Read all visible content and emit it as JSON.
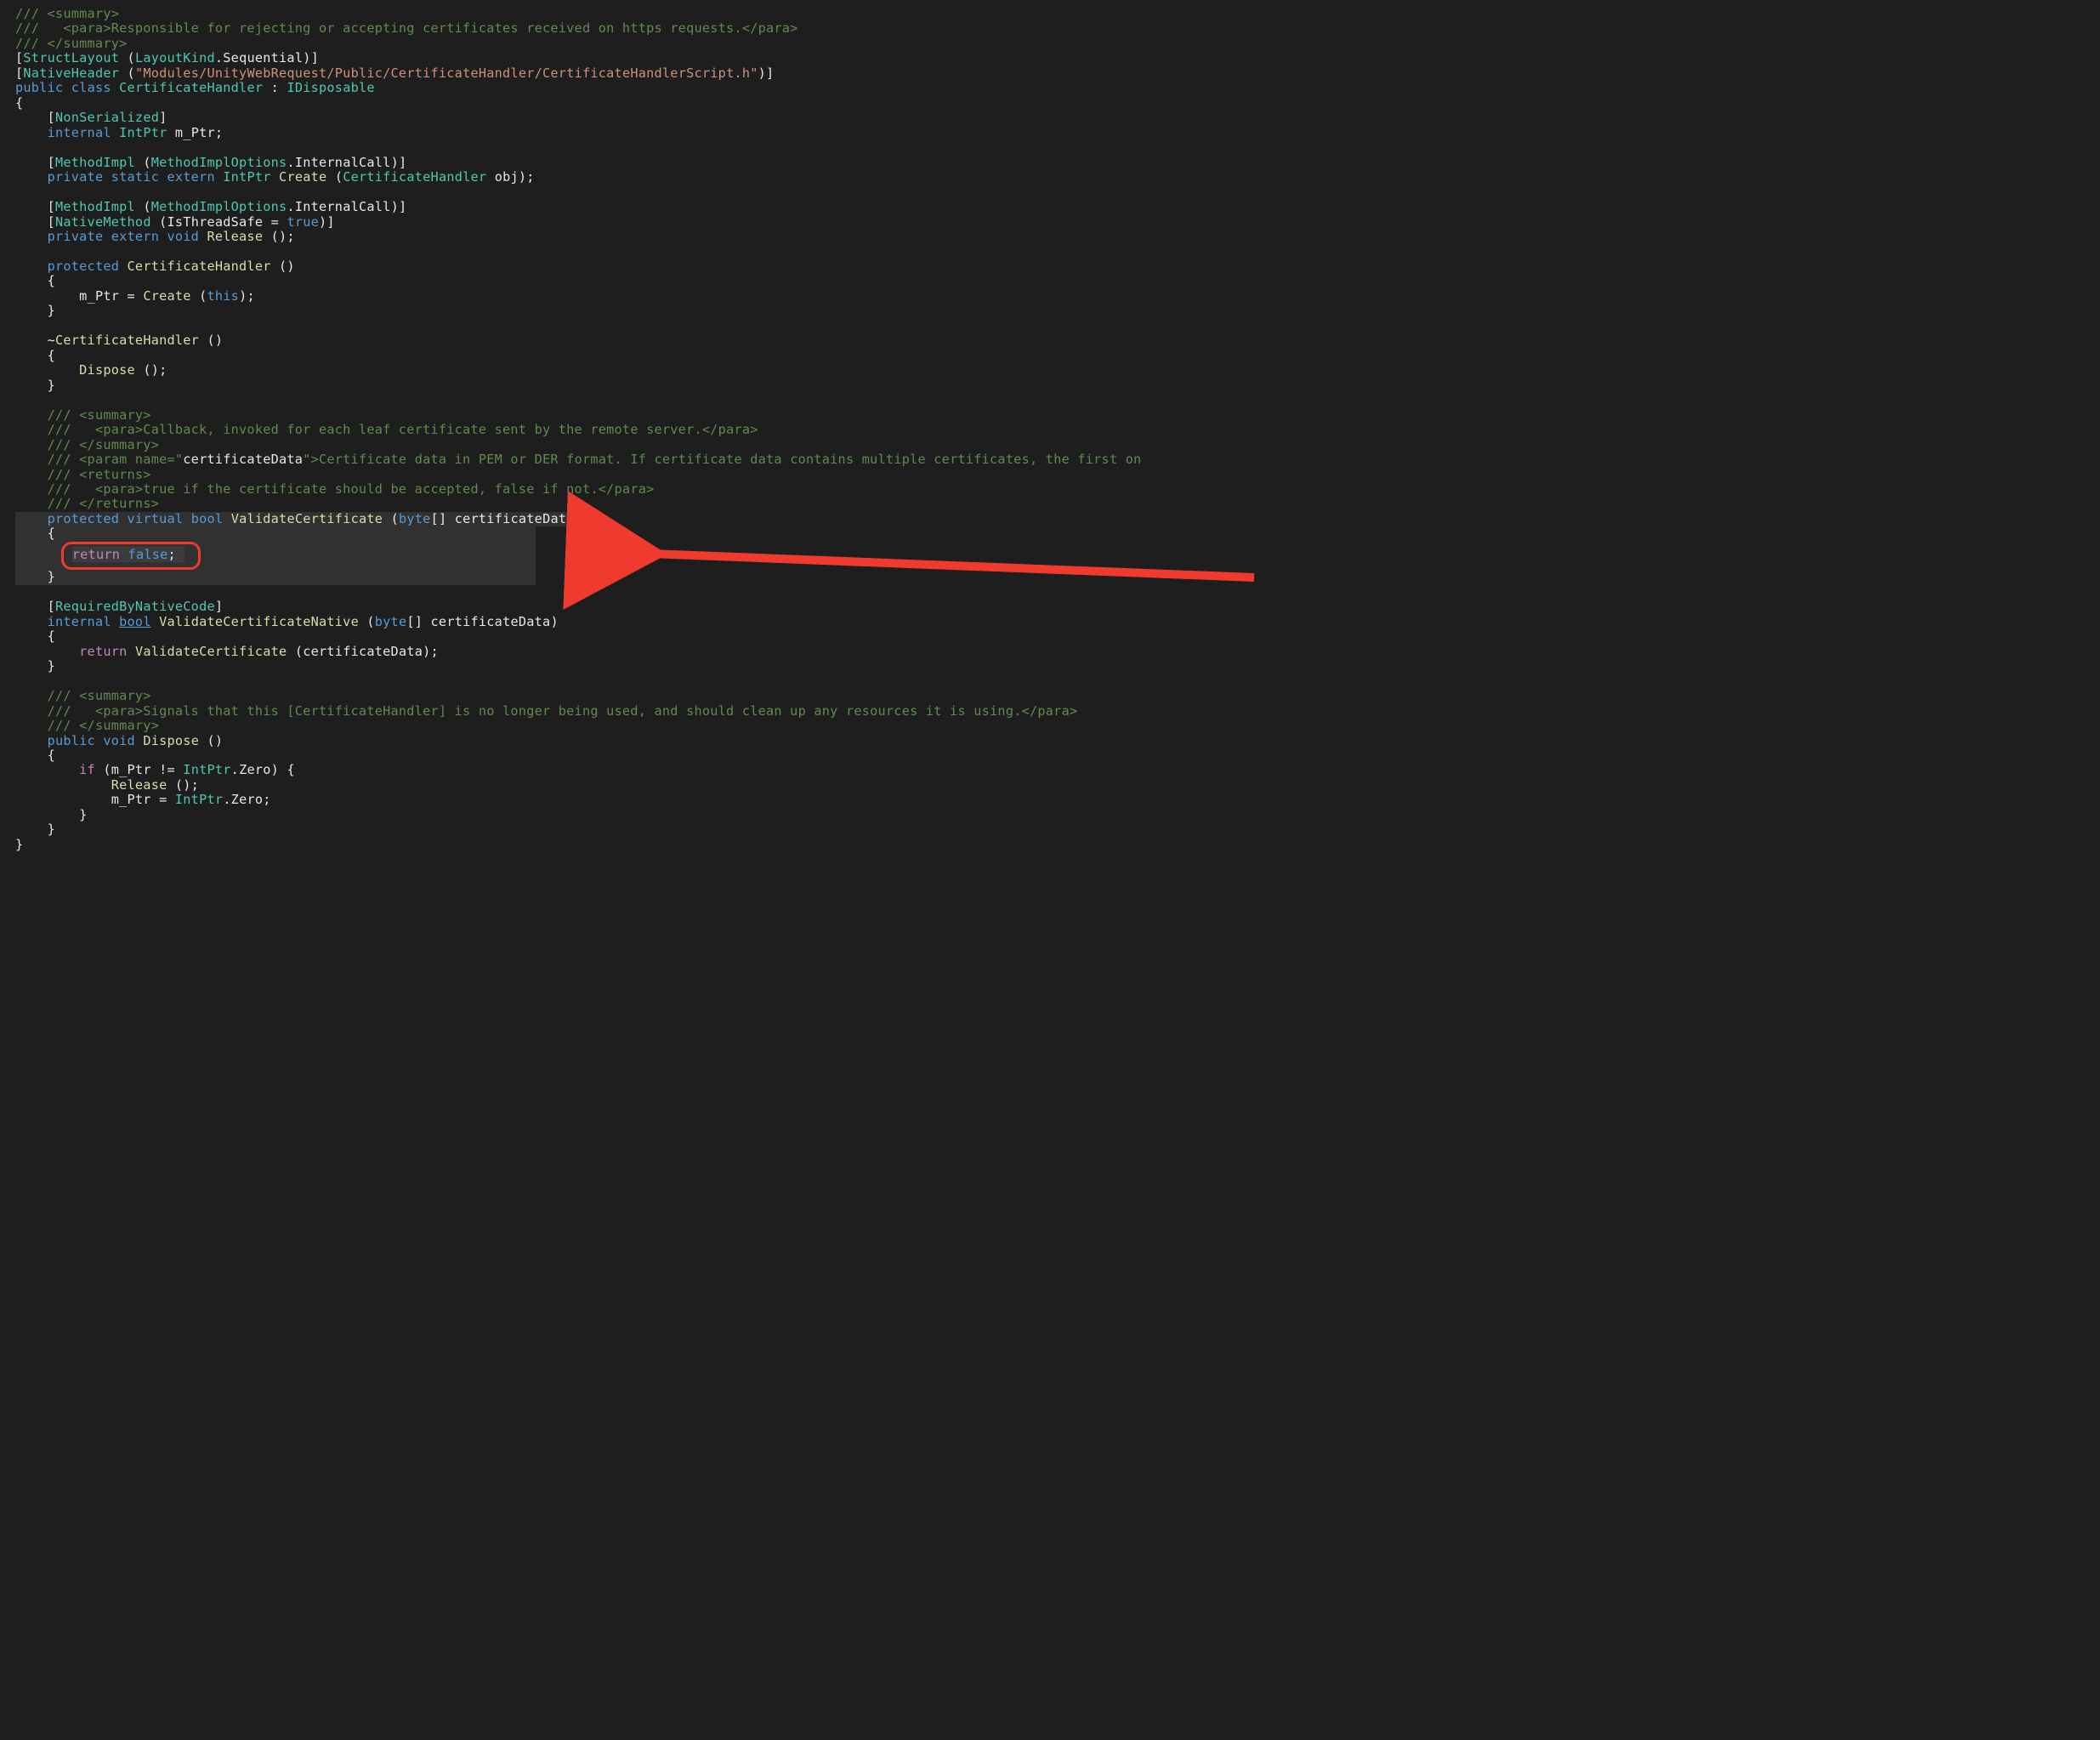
{
  "line01": "/// <summary>",
  "line02": "///   <para>Responsible for rejecting or accepting certificates received on https requests.</para>",
  "line03": "/// </summary>",
  "attr1_name": "StructLayout",
  "attr1_arg_a": "LayoutKind",
  "attr1_arg_b": "Sequential",
  "attr2_name": "NativeHeader",
  "attr2_arg": "\"Modules/UnityWebRequest/Public/CertificateHandler/CertificateHandlerScript.h\"",
  "class_decl_kw1": "public",
  "class_decl_kw2": "class",
  "class_name": "CertificateHandler",
  "class_iface": "IDisposable",
  "nonserialized": "NonSerialized",
  "field_mod": "internal",
  "intptr": "IntPtr",
  "mptr_name": "m_Ptr",
  "mi_name": "MethodImpl",
  "mi_opts_a": "MethodImplOptions",
  "mi_opts_b": "InternalCall",
  "create_mods": "private static extern",
  "create_name": "Create",
  "create_param_type": "CertificateHandler",
  "create_param_name": "obj",
  "nm_name": "NativeMethod",
  "nm_inner": "(IsThreadSafe = ",
  "nm_true": "true",
  "release_mods": "private extern void",
  "release_name": "Release",
  "ctor_mod": "protected",
  "ctor_name": "CertificateHandler",
  "ctor_body_a": "m_Ptr = ",
  "ctor_body_b": "Create",
  "ctor_body_this": "this",
  "dtor_prefix": "~",
  "dtor_body": "Dispose",
  "sum2_l1": "/// <summary>",
  "sum2_l2": "///   <para>Callback, invoked for each leaf certificate sent by the remote server.</para>",
  "sum2_l3": "/// </summary>",
  "param_open": "/// <param name=\"",
  "param_name": "certificateData",
  "param_rest": "\">Certificate data in PEM or DER format. If certificate data contains multiple certificates, the first on",
  "ret_l1": "/// <returns>",
  "ret_l2": "///   <para>true if the certificate should be accepted, false if not.</para>",
  "ret_l3": "/// </returns>",
  "vc_mod1": "protected",
  "vc_mod2": "virtual",
  "vc_ret": "bool",
  "vc_name": "ValidateCertificate",
  "byte_kw": "byte",
  "vc_param": "certificateData",
  "ret_kw": "return",
  "false_kw": "false",
  "rbnc": "RequiredByNativeCode",
  "vcn_mod": "internal",
  "vcn_ret": "bool",
  "vcn_name": "ValidateCertificateNative",
  "vcn_body_ret": "return",
  "vcn_body_call": "ValidateCertificate",
  "vcn_body_arg": "(certificateData);",
  "sum3_l1": "/// <summary>",
  "sum3_l2": "///   <para>Signals that this [CertificateHandler] is no longer being used, and should clean up any resources it is using.</para>",
  "sum3_l3": "/// </summary>",
  "disp_mod": "public",
  "void_kw": "void",
  "disp_name": "Dispose",
  "if_kw": "if",
  "zero": "Zero",
  "arrow_color": "#ef3a2f",
  "highlight_fn": "ValidateCertificate"
}
